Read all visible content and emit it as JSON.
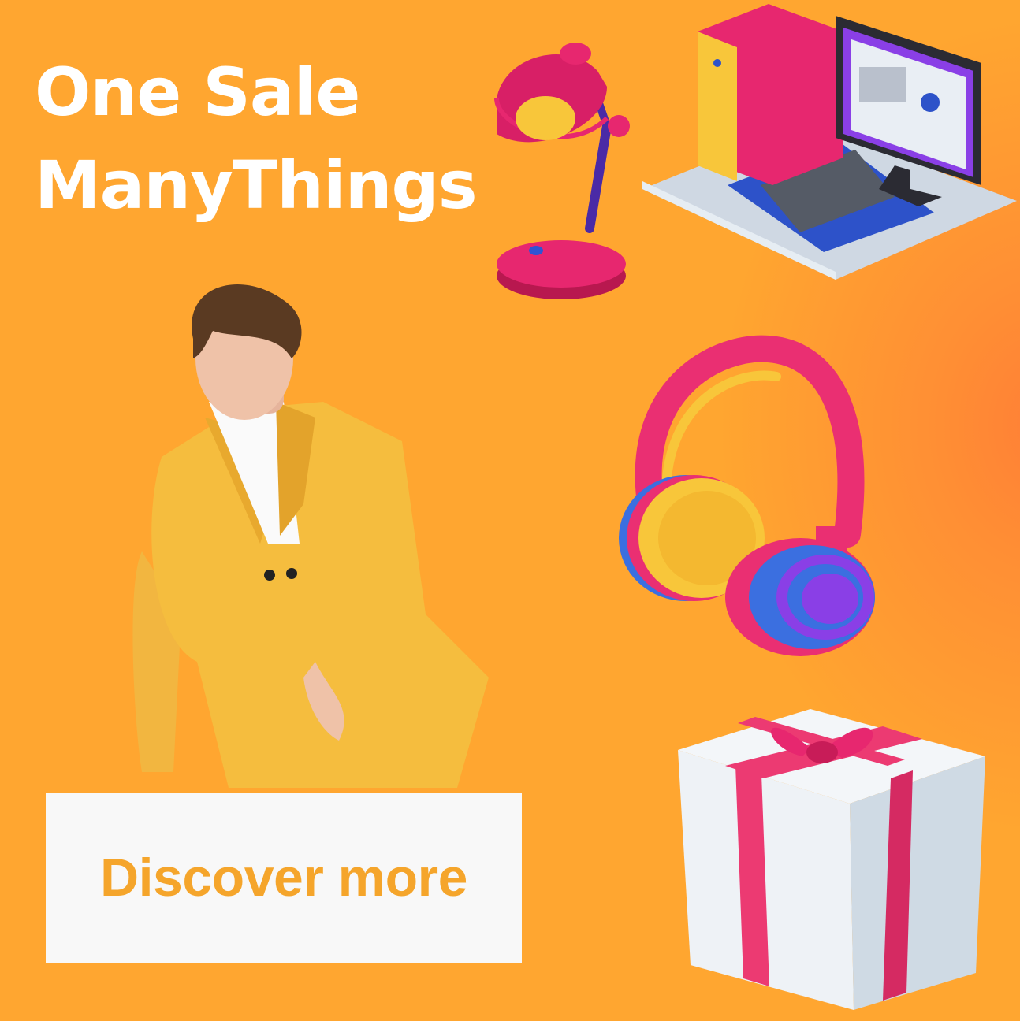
{
  "banner": {
    "headline_line1": "One Sale",
    "headline_line2": "ManyThings",
    "cta_label": "Discover more"
  },
  "colors": {
    "background": "#ffa630",
    "background_accent": "#ff7f36",
    "headline_text": "#ffffff",
    "cta_background": "#f8f8f8",
    "cta_text": "#f5a52b",
    "product_pink": "#f0306e",
    "product_yellow": "#f8c63a",
    "product_blue": "#3b6fe0",
    "product_purple": "#8a3fe6"
  },
  "illustrations": [
    "desk-lamp-illustration",
    "desktop-computer-illustration",
    "headphones-illustration",
    "model-photo",
    "gift-box-illustration"
  ]
}
